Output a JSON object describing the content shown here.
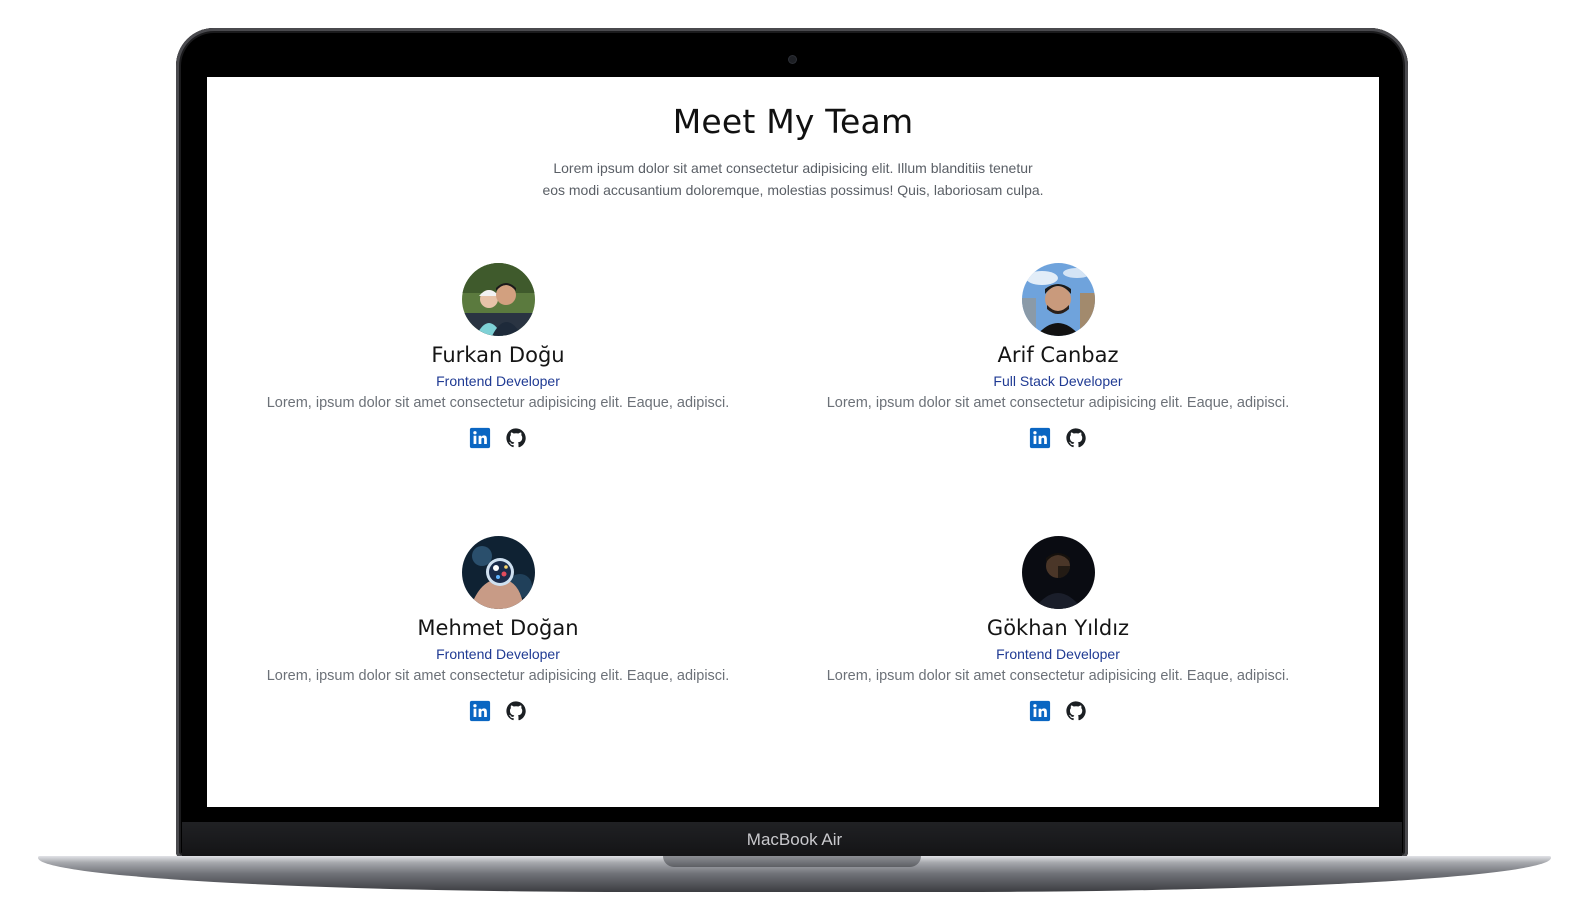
{
  "device": {
    "label": "MacBook Air"
  },
  "page": {
    "title": "Meet My Team",
    "intro_line1": "Lorem ipsum dolor sit amet consectetur adipisicing elit. Illum blanditiis tenetur",
    "intro_line2": "eos modi accusantium doloremque, molestias possimus! Quis, laboriosam culpa."
  },
  "members": [
    {
      "name": "Furkan Doğu",
      "role": "Frontend Developer",
      "description": "Lorem, ipsum dolor sit amet consectetur adipisicing elit. Eaque, adipisci.",
      "links": [
        "linkedin-icon",
        "github-icon"
      ]
    },
    {
      "name": "Arif Canbaz",
      "role": "Full Stack Developer",
      "description": "Lorem, ipsum dolor sit amet consectetur adipisicing elit. Eaque, adipisci.",
      "links": [
        "linkedin-icon",
        "github-icon"
      ]
    },
    {
      "name": "Mehmet Doğan",
      "role": "Frontend Developer",
      "description": "Lorem, ipsum dolor sit amet consectetur adipisicing elit. Eaque, adipisci.",
      "links": [
        "linkedin-icon",
        "github-icon"
      ]
    },
    {
      "name": "Gökhan Yıldız",
      "role": "Frontend Developer",
      "description": "Lorem, ipsum dolor sit amet consectetur adipisicing elit. Eaque, adipisci.",
      "links": [
        "linkedin-icon",
        "github-icon"
      ]
    }
  ],
  "colors": {
    "role_text": "#1f3a93",
    "linkedin": "#0a66c2",
    "github": "#1b1f23"
  }
}
